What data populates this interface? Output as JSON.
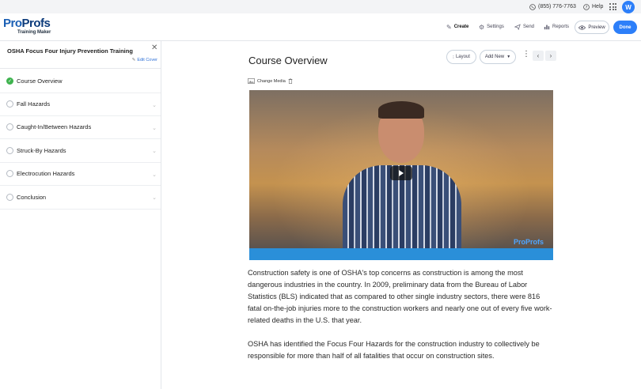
{
  "topbar": {
    "phone": "(855) 776-7763",
    "help": "Help",
    "avatar_initial": "W"
  },
  "header": {
    "logo_main_1": "Pro",
    "logo_main_2": "Profs",
    "logo_sub": "Training Maker",
    "nav": {
      "create": "Create",
      "settings": "Settings",
      "send": "Send",
      "reports": "Reports"
    },
    "preview": "Preview",
    "done": "Done"
  },
  "sidebar": {
    "title": "OSHA Focus Four Injury Prevention Training",
    "edit_cover": "Edit Cover",
    "items": [
      {
        "label": "Course Overview"
      },
      {
        "label": "Fall Hazards"
      },
      {
        "label": "Caught-In/Between Hazards"
      },
      {
        "label": "Struck-By Hazards"
      },
      {
        "label": "Electrocution Hazards"
      },
      {
        "label": "Conclusion"
      }
    ]
  },
  "main": {
    "title": "Course Overview",
    "layout": "Layout",
    "add_new": "Add New",
    "change_media": "Change Media",
    "video_watermark": "ProProfs",
    "paragraph1": "Construction safety is one of OSHA's top concerns as construction is among the most dangerous industries in the country. In 2009, preliminary data from the Bureau of Labor Statistics (BLS) indicated that as compared to other single industry sectors, there were 816 fatal on-the-job injuries more to the construction workers and nearly one out of every five work-related deaths in the U.S. that year.",
    "paragraph2": "OSHA has identified the Focus Four Hazards for the construction industry to collectively be responsible for more than half of all fatalities that occur on construction sites."
  },
  "colors": {
    "accent": "#2d7ff9",
    "complete": "#3fb34f"
  }
}
